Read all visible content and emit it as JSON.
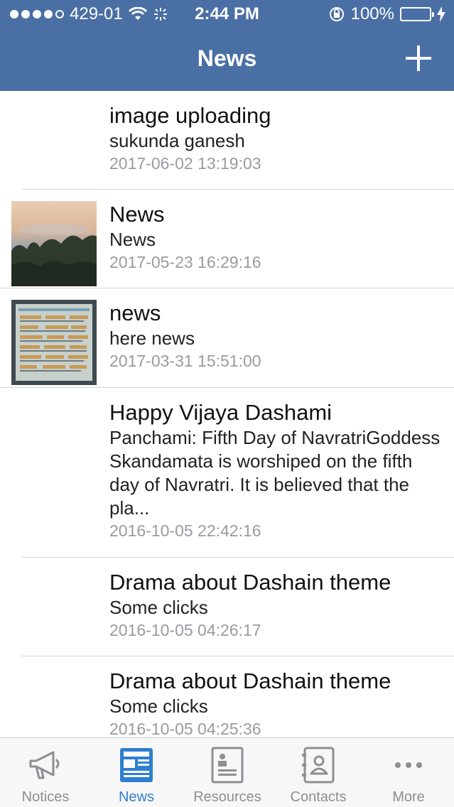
{
  "status_bar": {
    "carrier": "429-01",
    "time": "2:44 PM",
    "battery": "100%"
  },
  "nav": {
    "title": "News"
  },
  "news_items": [
    {
      "title": "image uploading",
      "subtitle": "sukunda ganesh",
      "date": "2017-06-02 13:19:03",
      "has_thumbnail": false
    },
    {
      "title": "News",
      "subtitle": "News",
      "date": "2017-05-23 16:29:16",
      "has_thumbnail": true,
      "thumbnail": "sunset-clouds-trees-photo"
    },
    {
      "title": "news",
      "subtitle": "here news",
      "date": "2017-03-31 15:51:00",
      "has_thumbnail": true,
      "thumbnail": "notice-paper-photo"
    },
    {
      "title": "Happy Vijaya Dashami",
      "subtitle": "Panchami: Fifth Day of NavratriGoddess Skandamata is worshiped on the fifth day of Navratri. It is believed that the pla...",
      "date": "2016-10-05 22:42:16",
      "has_thumbnail": false
    },
    {
      "title": "Drama about Dashain theme",
      "subtitle": "Some clicks",
      "date": "2016-10-05 04:26:17",
      "has_thumbnail": false
    },
    {
      "title": "Drama about Dashain theme",
      "subtitle": "Some clicks",
      "date": "2016-10-05 04:25:36",
      "has_thumbnail": false
    }
  ],
  "tab_bar": {
    "tabs": [
      {
        "label": "Notices",
        "icon": "megaphone-icon",
        "active": false
      },
      {
        "label": "News",
        "icon": "newspaper-icon",
        "active": true
      },
      {
        "label": "Resources",
        "icon": "document-icon",
        "active": false
      },
      {
        "label": "Contacts",
        "icon": "address-book-icon",
        "active": false
      },
      {
        "label": "More",
        "icon": "ellipsis-icon",
        "active": false
      }
    ]
  },
  "colors": {
    "nav_background": "#4a6fa5",
    "active_tab": "#2f7fd0",
    "inactive_tab": "#8e8e93",
    "date_text": "#9a9aa2"
  }
}
